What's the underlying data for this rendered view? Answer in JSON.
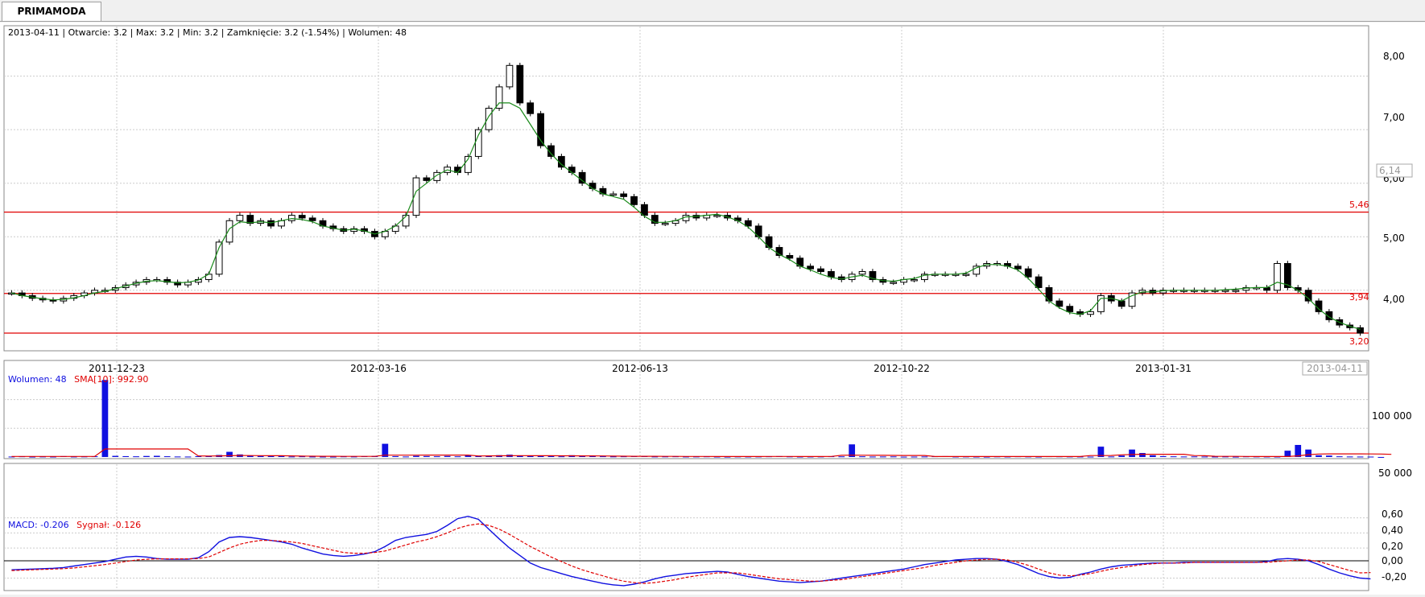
{
  "tab": {
    "label": "PRIMAMODA"
  },
  "info": {
    "text": "2013-04-11 | Otwarcie: 3.2 | Max: 3.2 | Min: 3.2 | Zamknięcie: 3.2 (-1.54%)  | Wolumen: 48"
  },
  "volume_legend": {
    "label1": "Wolumen: 48",
    "label2": "SMA[10]: 992.90"
  },
  "macd_legend": {
    "label1": "MACD: -0.206",
    "label2": "Sygnał: -0.126"
  },
  "price_axis": {
    "ticks": [
      "8,00",
      "7,00",
      "6,00",
      "5,00",
      "4,00"
    ],
    "current": "6,14"
  },
  "levels": [
    "5,46",
    "3,94",
    "3,20"
  ],
  "date_labels": [
    "2011-12-23",
    "2012-03-16",
    "2012-06-13",
    "2012-10-22",
    "2013-01-31"
  ],
  "last_date": "2013-04-11",
  "volume_axis": {
    "ticks": [
      "100 000",
      "50 000"
    ]
  },
  "macd_axis": {
    "ticks": [
      "0,60",
      "0,40",
      "0,20",
      "0,00",
      "-0,20"
    ]
  },
  "colors": {
    "ma": "#1a8a1a",
    "level": "#e00000",
    "volume": "#1010e0",
    "sma": "#e00000",
    "macd": "#1010e0",
    "signal": "#e00000"
  },
  "chart_data": [
    {
      "type": "candlestick",
      "title": "PRIMAMODA",
      "x_range": [
        "2011-11-10",
        "2013-04-11"
      ],
      "ylim": [
        3.2,
        8.4
      ],
      "levels": [
        5.46,
        3.94,
        3.2
      ],
      "close": [
        3.95,
        3.9,
        3.85,
        3.82,
        3.8,
        3.85,
        3.9,
        3.95,
        4.0,
        4.0,
        4.05,
        4.1,
        4.15,
        4.2,
        4.2,
        4.15,
        4.1,
        4.15,
        4.2,
        4.3,
        4.9,
        5.3,
        5.4,
        5.25,
        5.3,
        5.2,
        5.3,
        5.4,
        5.35,
        5.3,
        5.2,
        5.15,
        5.1,
        5.15,
        5.1,
        5.0,
        5.1,
        5.2,
        5.4,
        6.1,
        6.05,
        6.2,
        6.3,
        6.2,
        6.5,
        7.0,
        7.4,
        7.8,
        8.2,
        7.5,
        7.3,
        6.7,
        6.5,
        6.3,
        6.2,
        6.0,
        5.9,
        5.8,
        5.8,
        5.75,
        5.6,
        5.4,
        5.25,
        5.25,
        5.3,
        5.4,
        5.35,
        5.4,
        5.4,
        5.35,
        5.3,
        5.2,
        5.0,
        4.8,
        4.65,
        4.6,
        4.45,
        4.4,
        4.35,
        4.25,
        4.2,
        4.3,
        4.35,
        4.2,
        4.15,
        4.15,
        4.2,
        4.2,
        4.3,
        4.3,
        4.3,
        4.3,
        4.3,
        4.45,
        4.5,
        4.5,
        4.45,
        4.4,
        4.25,
        4.05,
        3.8,
        3.7,
        3.6,
        3.55,
        3.6,
        3.9,
        3.8,
        3.7,
        3.95,
        4.0,
        3.95,
        4.0,
        4.0,
        4.0,
        4.0,
        4.0,
        4.0,
        4.0,
        4.0,
        4.05,
        4.05,
        4.0,
        4.5,
        4.05,
        4.0,
        3.8,
        3.6,
        3.45,
        3.35,
        3.3,
        3.2
      ],
      "ma_close": [
        3.95,
        3.9,
        3.87,
        3.84,
        3.82,
        3.83,
        3.86,
        3.9,
        3.95,
        3.98,
        4.03,
        4.08,
        4.13,
        4.17,
        4.18,
        4.16,
        4.14,
        4.15,
        4.19,
        4.3,
        4.8,
        5.15,
        5.28,
        5.26,
        5.28,
        5.26,
        5.3,
        5.34,
        5.32,
        5.28,
        5.2,
        5.16,
        5.12,
        5.14,
        5.11,
        5.05,
        5.1,
        5.2,
        5.38,
        5.85,
        6.0,
        6.15,
        6.25,
        6.2,
        6.45,
        6.9,
        7.25,
        7.5,
        7.5,
        7.4,
        7.1,
        6.8,
        6.55,
        6.35,
        6.2,
        6.05,
        5.9,
        5.8,
        5.75,
        5.7,
        5.55,
        5.38,
        5.27,
        5.27,
        5.3,
        5.37,
        5.38,
        5.4,
        5.42,
        5.37,
        5.3,
        5.18,
        5.0,
        4.8,
        4.67,
        4.57,
        4.45,
        4.38,
        4.3,
        4.24,
        4.21,
        4.25,
        4.28,
        4.22,
        4.18,
        4.17,
        4.2,
        4.22,
        4.28,
        4.3,
        4.3,
        4.3,
        4.32,
        4.42,
        4.48,
        4.48,
        4.45,
        4.38,
        4.22,
        4.02,
        3.8,
        3.67,
        3.58,
        3.55,
        3.62,
        3.85,
        3.85,
        3.8,
        3.9,
        3.97,
        3.97,
        3.99,
        4.0,
        4.0,
        4.0,
        4.0,
        4.0,
        4.01,
        4.02,
        4.04,
        4.05,
        4.05,
        4.15,
        4.1,
        4.0,
        3.85,
        3.65,
        3.5,
        3.4,
        3.33,
        3.27
      ]
    },
    {
      "type": "bar",
      "title": "Wolumen",
      "values": [
        800,
        1200,
        600,
        900,
        700,
        1500,
        800,
        1000,
        1300,
        134000,
        2000,
        1500,
        1200,
        1800,
        2100,
        1300,
        900,
        800,
        1500,
        2000,
        3500,
        9000,
        4500,
        2000,
        1800,
        2500,
        1500,
        900,
        1200,
        800,
        700,
        600,
        1100,
        900,
        1400,
        1800,
        23000,
        1500,
        900,
        2000,
        1600,
        1300,
        1800,
        1200,
        2600,
        2200,
        1700,
        3200,
        4100,
        2800,
        1600,
        2300,
        1500,
        1200,
        3100,
        2000,
        1400,
        1300,
        1000,
        1200,
        1500,
        1800,
        900,
        1000,
        1200,
        800,
        900,
        1100,
        700,
        600,
        900,
        800,
        900,
        1200,
        1500,
        1000,
        700,
        800,
        900,
        1300,
        1100,
        22000,
        1200,
        800,
        900,
        1000,
        600,
        700,
        900,
        1300,
        1500,
        800,
        900,
        700,
        600,
        1000,
        800,
        1200,
        900,
        700,
        1300,
        1100,
        900,
        800,
        700,
        18000,
        900,
        2500,
        13000,
        7000,
        3000,
        1500,
        1200,
        900,
        1000,
        800,
        700,
        900,
        600,
        1100,
        900,
        800,
        700,
        11000,
        21000,
        13000,
        3000,
        2500,
        1200,
        900,
        800,
        700,
        48
      ],
      "sma10": [
        1000,
        1000,
        1000,
        1000,
        1000,
        1000,
        1000,
        1000,
        1000,
        14000,
        14000,
        14000,
        14000,
        14000,
        14000,
        14000,
        14000,
        14000,
        1800,
        1700,
        1900,
        2200,
        2600,
        2500,
        2400,
        2300,
        2200,
        2000,
        1600,
        1400,
        1300,
        1200,
        1100,
        1100,
        1100,
        1100,
        3200,
        3200,
        3200,
        3200,
        3300,
        3300,
        3400,
        3300,
        3400,
        1800,
        1900,
        2100,
        2300,
        2400,
        2300,
        2300,
        2200,
        2100,
        2100,
        2000,
        1900,
        1800,
        1600,
        1400,
        1300,
        1200,
        1200,
        1100,
        1100,
        1000,
        1000,
        1000,
        900,
        900,
        900,
        900,
        900,
        1000,
        1000,
        1000,
        900,
        900,
        900,
        1000,
        3000,
        3200,
        3100,
        3000,
        2900,
        2800,
        2700,
        2700,
        2700,
        800,
        900,
        900,
        900,
        800,
        800,
        800,
        800,
        900,
        900,
        900,
        900,
        900,
        900,
        800,
        2500,
        2500,
        2600,
        3800,
        4400,
        4700,
        4700,
        4700,
        4700,
        4700,
        2500,
        2300,
        1200,
        1100,
        1100,
        1000,
        900,
        900,
        900,
        900,
        2000,
        4000,
        5200,
        5400,
        5500,
        5500,
        5400,
        5300,
        5200,
        4600
      ],
      "ylim": [
        0,
        140000
      ]
    },
    {
      "type": "line",
      "title": "MACD",
      "series_names": [
        "MACD",
        "Sygnał"
      ],
      "macd": [
        -0.09,
        -0.085,
        -0.08,
        -0.075,
        -0.07,
        -0.06,
        -0.04,
        -0.02,
        0.0,
        0.02,
        0.05,
        0.08,
        0.09,
        0.08,
        0.06,
        0.05,
        0.05,
        0.05,
        0.07,
        0.15,
        0.28,
        0.34,
        0.35,
        0.34,
        0.32,
        0.3,
        0.28,
        0.25,
        0.2,
        0.16,
        0.12,
        0.1,
        0.09,
        0.1,
        0.12,
        0.15,
        0.22,
        0.3,
        0.34,
        0.36,
        0.38,
        0.42,
        0.5,
        0.59,
        0.62,
        0.58,
        0.45,
        0.32,
        0.2,
        0.1,
        0.0,
        -0.06,
        -0.1,
        -0.14,
        -0.18,
        -0.21,
        -0.24,
        -0.27,
        -0.29,
        -0.3,
        -0.28,
        -0.25,
        -0.21,
        -0.18,
        -0.16,
        -0.14,
        -0.13,
        -0.12,
        -0.11,
        -0.12,
        -0.15,
        -0.18,
        -0.2,
        -0.22,
        -0.24,
        -0.25,
        -0.26,
        -0.25,
        -0.24,
        -0.22,
        -0.2,
        -0.18,
        -0.16,
        -0.14,
        -0.12,
        -0.1,
        -0.08,
        -0.05,
        -0.02,
        0.0,
        0.02,
        0.04,
        0.05,
        0.06,
        0.06,
        0.05,
        0.02,
        -0.02,
        -0.08,
        -0.14,
        -0.18,
        -0.2,
        -0.19,
        -0.15,
        -0.12,
        -0.08,
        -0.05,
        -0.03,
        -0.02,
        -0.01,
        0.0,
        0.0,
        0.0,
        0.01,
        0.01,
        0.01,
        0.01,
        0.01,
        0.01,
        0.01,
        0.01,
        0.02,
        0.05,
        0.06,
        0.05,
        0.03,
        -0.02,
        -0.08,
        -0.13,
        -0.17,
        -0.2,
        -0.21
      ],
      "signal": [
        -0.1,
        -0.095,
        -0.09,
        -0.085,
        -0.08,
        -0.075,
        -0.065,
        -0.05,
        -0.035,
        -0.02,
        0.0,
        0.02,
        0.04,
        0.05,
        0.055,
        0.055,
        0.055,
        0.055,
        0.06,
        0.08,
        0.14,
        0.2,
        0.25,
        0.28,
        0.3,
        0.3,
        0.29,
        0.28,
        0.26,
        0.23,
        0.2,
        0.17,
        0.14,
        0.13,
        0.13,
        0.14,
        0.16,
        0.2,
        0.24,
        0.28,
        0.31,
        0.35,
        0.4,
        0.46,
        0.5,
        0.52,
        0.5,
        0.45,
        0.38,
        0.3,
        0.22,
        0.15,
        0.08,
        0.02,
        -0.04,
        -0.09,
        -0.13,
        -0.17,
        -0.21,
        -0.24,
        -0.26,
        -0.27,
        -0.26,
        -0.24,
        -0.22,
        -0.19,
        -0.17,
        -0.15,
        -0.13,
        -0.13,
        -0.13,
        -0.15,
        -0.17,
        -0.19,
        -0.21,
        -0.22,
        -0.23,
        -0.24,
        -0.24,
        -0.23,
        -0.22,
        -0.2,
        -0.18,
        -0.16,
        -0.14,
        -0.12,
        -0.1,
        -0.08,
        -0.06,
        -0.03,
        -0.01,
        0.01,
        0.03,
        0.04,
        0.05,
        0.05,
        0.04,
        0.01,
        -0.03,
        -0.08,
        -0.13,
        -0.16,
        -0.17,
        -0.16,
        -0.14,
        -0.11,
        -0.08,
        -0.06,
        -0.04,
        -0.02,
        -0.01,
        0.0,
        0.0,
        0.0,
        0.01,
        0.01,
        0.01,
        0.01,
        0.01,
        0.01,
        0.01,
        0.01,
        0.02,
        0.03,
        0.04,
        0.04,
        0.02,
        -0.02,
        -0.06,
        -0.1,
        -0.13,
        -0.126
      ],
      "ylim": [
        -0.28,
        0.66
      ]
    }
  ]
}
